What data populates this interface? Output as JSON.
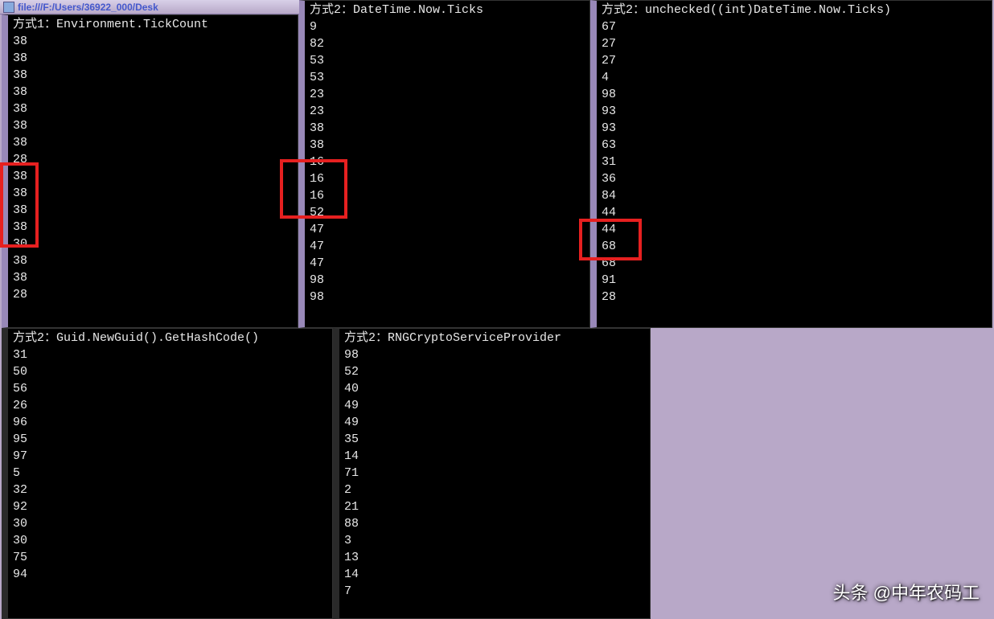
{
  "titlebar": {
    "url": "file:///F:/Users/36922_000/Desk"
  },
  "panels": {
    "p1": {
      "title": "方式1：Environment.TickCount",
      "lines": [
        "38",
        "38",
        "38",
        "38",
        "38",
        "38",
        "38",
        "28",
        "38",
        "38",
        "38",
        "38",
        "30",
        "38",
        "38",
        "28"
      ]
    },
    "p2": {
      "title": "方式2：DateTime.Now.Ticks",
      "lines": [
        "9",
        "82",
        "53",
        "53",
        "23",
        "23",
        "38",
        "38",
        "16",
        "16",
        "16",
        "52",
        "47",
        "47",
        "47",
        "98",
        "98"
      ]
    },
    "p3": {
      "title": "方式2：unchecked((int)DateTime.Now.Ticks)",
      "lines": [
        "67",
        "27",
        "27",
        "4",
        "98",
        "93",
        "93",
        "63",
        "31",
        "36",
        "84",
        "44",
        "44",
        "68",
        "68",
        "91",
        "28"
      ]
    },
    "p4": {
      "title": "方式2：Guid.NewGuid().GetHashCode()",
      "lines": [
        "31",
        "50",
        "56",
        "26",
        "96",
        "95",
        "97",
        "5",
        "32",
        "92",
        "30",
        "30",
        "75",
        "94"
      ]
    },
    "p5": {
      "title": "方式2：RNGCryptoServiceProvider",
      "lines": [
        "98",
        "52",
        "40",
        "49",
        "49",
        "35",
        "14",
        "71",
        "2",
        "21",
        "88",
        "3",
        "13",
        "14",
        "7"
      ]
    }
  },
  "watermark": "头条 @中年农码工"
}
